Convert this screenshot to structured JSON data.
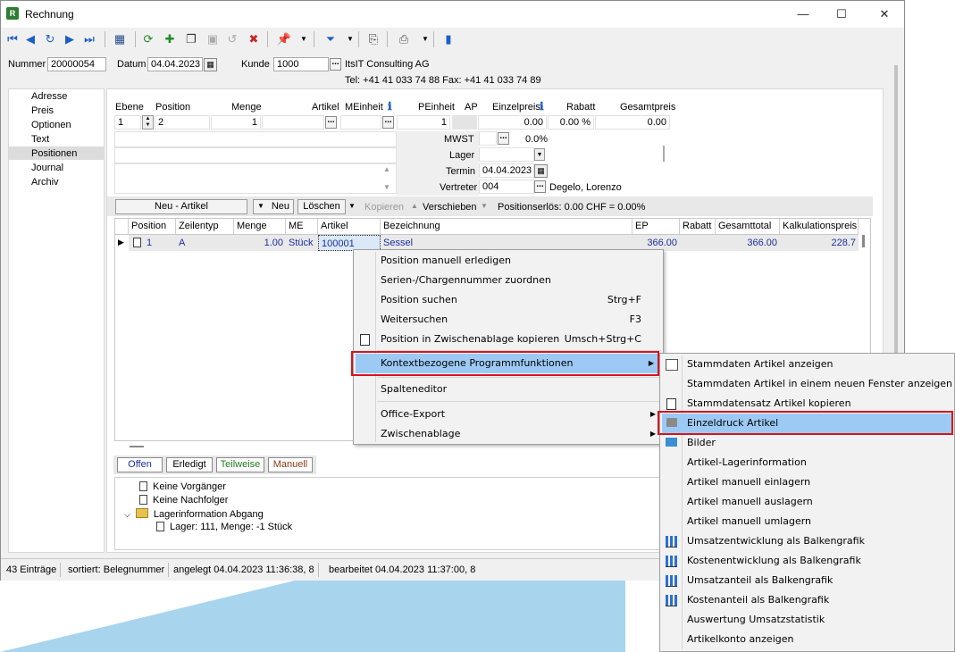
{
  "window": {
    "title": "Rechnung",
    "minimize": "—",
    "maximize": "☐",
    "close": "✕"
  },
  "header": {
    "nummer_label": "Nummer",
    "nummer_value": "20000054",
    "datum_label": "Datum",
    "datum_value": "04.04.2023",
    "kunde_label": "Kunde",
    "kunde_value": "1000",
    "kunde_name": "ItsIT Consulting AG",
    "kunde_contact": "Tel: +41 41 033 74 88   Fax: +41 41 033 74 89"
  },
  "nav": {
    "items": [
      "Adresse",
      "Preis",
      "Optionen",
      "Text",
      "Positionen",
      "Journal",
      "Archiv"
    ],
    "selected": "Positionen"
  },
  "position_form": {
    "headers": {
      "ebene": "Ebene",
      "position": "Position",
      "menge": "Menge",
      "artikel": "Artikel",
      "meinheit": "MEinheit",
      "peinheit": "PEinheit",
      "ap": "AP",
      "einzelpreis": "Einzelpreis",
      "rabatt": "Rabatt",
      "gesamtpreis": "Gesamtpreis"
    },
    "values": {
      "ebene": "1",
      "position": "2",
      "menge": "1",
      "peinheit": "1",
      "einzelpreis": "0.00",
      "rabatt": "0.00 %",
      "gesamtpreis": "0.00"
    },
    "mwst_label": "MWST",
    "mwst_value": "0.0%",
    "lager_label": "Lager",
    "termin_label": "Termin",
    "termin_value": "04.04.2023",
    "vertreter_label": "Vertreter",
    "vertreter_value": "004",
    "vertreter_name": "Degelo, Lorenzo"
  },
  "grid_toolbar": {
    "neu_artikel": "Neu - Artikel",
    "neu": "Neu",
    "loeschen": "Löschen",
    "kopieren": "Kopieren",
    "verschieben": "Verschieben",
    "positionserloes": "Positionserlös:  0.00 CHF = 0.00%"
  },
  "grid": {
    "columns": [
      "Position",
      "Zeilentyp",
      "Menge",
      "ME",
      "Artikel",
      "Bezeichnung",
      "EP",
      "Rabatt",
      "Gesamttotal",
      "Kalkulationspreis"
    ],
    "rows": [
      {
        "position": "1",
        "zeilentyp": "A",
        "menge": "1.00",
        "me": "Stück",
        "artikel": "100001",
        "bezeichnung": "Sessel",
        "ep": "366.00",
        "rabatt": "",
        "gesamttotal": "366.00",
        "kalkulationspreis": "228.7"
      }
    ]
  },
  "status_tabs": [
    "Offen",
    "Erledigt",
    "Teilweise",
    "Manuell"
  ],
  "tree": {
    "items": [
      "Keine Vorgänger",
      "Keine Nachfolger",
      "Lagerinformation Abgang",
      "Lager: 111, Menge: -1 Stück"
    ]
  },
  "statusbar": {
    "eintraege": "43 Einträge",
    "sortiert": "sortiert: Belegnummer",
    "angelegt": "angelegt 04.04.2023 11:36:38,  8",
    "bearbeitet": "bearbeitet 04.04.2023 11:37:00,  8"
  },
  "context_menu": {
    "items": [
      {
        "label": "Position manuell erledigen",
        "shortcut": ""
      },
      {
        "label": "Serien-/Chargennummer zuordnen",
        "shortcut": ""
      },
      {
        "label": "Position suchen",
        "shortcut": "Strg+F"
      },
      {
        "label": "Weitersuchen",
        "shortcut": "F3"
      },
      {
        "label": "Position in Zwischenablage kopieren",
        "shortcut": "Umsch+Strg+C"
      },
      {
        "label": "Kontextbezogene Programmfunktionen",
        "shortcut": ""
      },
      {
        "label": "Spalteneditor",
        "shortcut": ""
      },
      {
        "label": "Office-Export",
        "shortcut": ""
      },
      {
        "label": "Zwischenablage",
        "shortcut": ""
      }
    ]
  },
  "submenu": {
    "items": [
      "Stammdaten Artikel anzeigen",
      "Stammdaten Artikel in einem neuen Fenster anzeigen",
      "Stammdatensatz Artikel kopieren",
      "Einzeldruck Artikel",
      "Bilder",
      "Artikel-Lagerinformation",
      "Artikel manuell einlagern",
      "Artikel manuell auslagern",
      "Artikel manuell umlagern",
      "Umsatzentwicklung als Balkengrafik",
      "Kostenentwicklung als Balkengrafik",
      "Umsatzanteil als Balkengrafik",
      "Kostenanteil als Balkengrafik",
      "Auswertung Umsatzstatistik",
      "Artikelkonto anzeigen"
    ]
  },
  "colors": {
    "accent_blue": "#1a2fa0",
    "highlight": "#9ccaf5",
    "red_frame": "#d9141c"
  }
}
